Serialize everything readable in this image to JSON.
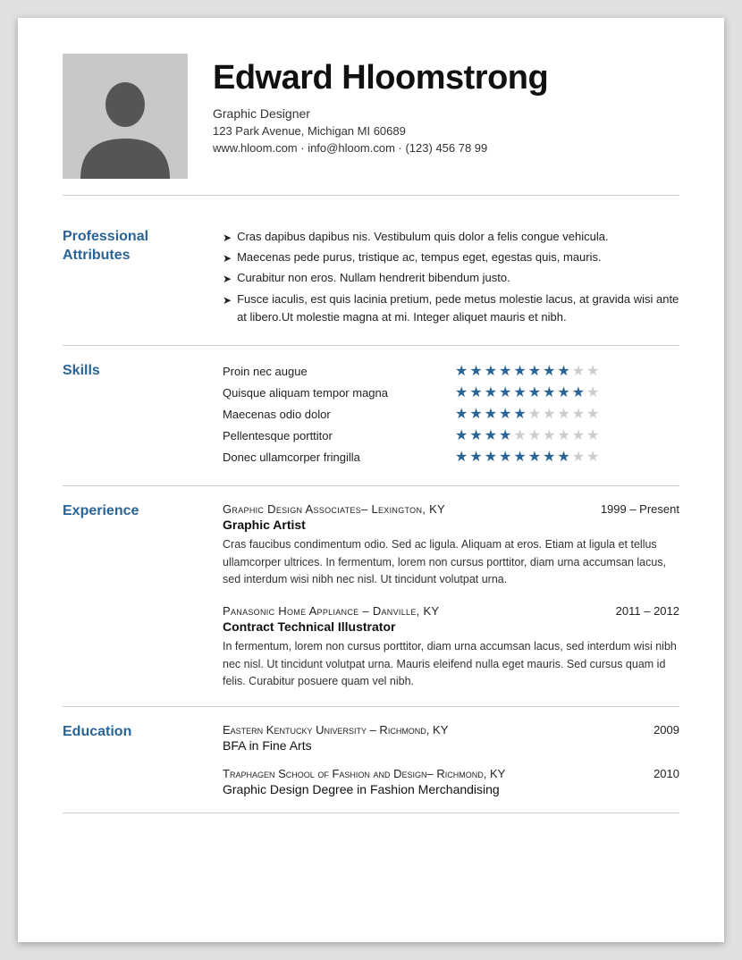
{
  "header": {
    "name": "Edward Hloomstrong",
    "title": "Graphic Designer",
    "address": "123 Park Avenue, Michigan MI 60689",
    "contact": "www.hloom.com · info@hloom.com · (123) 456 78 99"
  },
  "sections": {
    "professional": {
      "label": "Professional\nAttributes",
      "attributes": [
        "Cras dapibus dapibus nis. Vestibulum quis dolor a felis congue vehicula.",
        "Maecenas pede purus, tristique ac, tempus eget, egestas quis, mauris.",
        "Curabitur non eros. Nullam hendrerit bibendum justo.",
        "Fusce iaculis, est quis lacinia pretium, pede metus molestie lacus, at gravida wisi ante at libero.Ut molestie magna at mi. Integer aliquet mauris et nibh."
      ]
    },
    "skills": {
      "label": "Skills",
      "items": [
        {
          "name": "Proin nec augue",
          "filled": 8,
          "total": 10
        },
        {
          "name": "Quisque aliquam tempor magna",
          "filled": 9,
          "total": 10
        },
        {
          "name": "Maecenas odio dolor",
          "filled": 5,
          "total": 10
        },
        {
          "name": "Pellentesque porttitor",
          "filled": 4,
          "total": 10
        },
        {
          "name": "Donec ullamcorper fringilla",
          "filled": 8,
          "total": 10
        }
      ]
    },
    "experience": {
      "label": "Experience",
      "items": [
        {
          "company": "Graphic Design Associates– Lexington, KY",
          "dates": "1999 – Present",
          "role": "Graphic Artist",
          "description": "Cras faucibus condimentum odio. Sed ac ligula. Aliquam at eros. Etiam at ligula et tellus ullamcorper ultrices. In fermentum, lorem non cursus porttitor, diam urna accumsan lacus, sed interdum wisi nibh nec nisl. Ut tincidunt volutpat urna."
        },
        {
          "company": "Panasonic Home Appliance – Danville, KY",
          "dates": "2011 – 2012",
          "role": "Contract Technical Illustrator",
          "description": "In fermentum, lorem non cursus porttitor, diam urna accumsan lacus, sed interdum wisi nibh nec nisl. Ut tincidunt volutpat urna. Mauris eleifend nulla eget mauris. Sed cursus quam id felis. Curabitur posuere quam vel nibh."
        }
      ]
    },
    "education": {
      "label": "Education",
      "items": [
        {
          "school": "Eastern Kentucky University – Richmond, KY",
          "year": "2009",
          "degree": "BFA in Fine Arts"
        },
        {
          "school": "Traphagen School of Fashion and Design– Richmond, KY",
          "year": "2010",
          "degree": "Graphic Design Degree in Fashion Merchandising"
        }
      ]
    }
  }
}
